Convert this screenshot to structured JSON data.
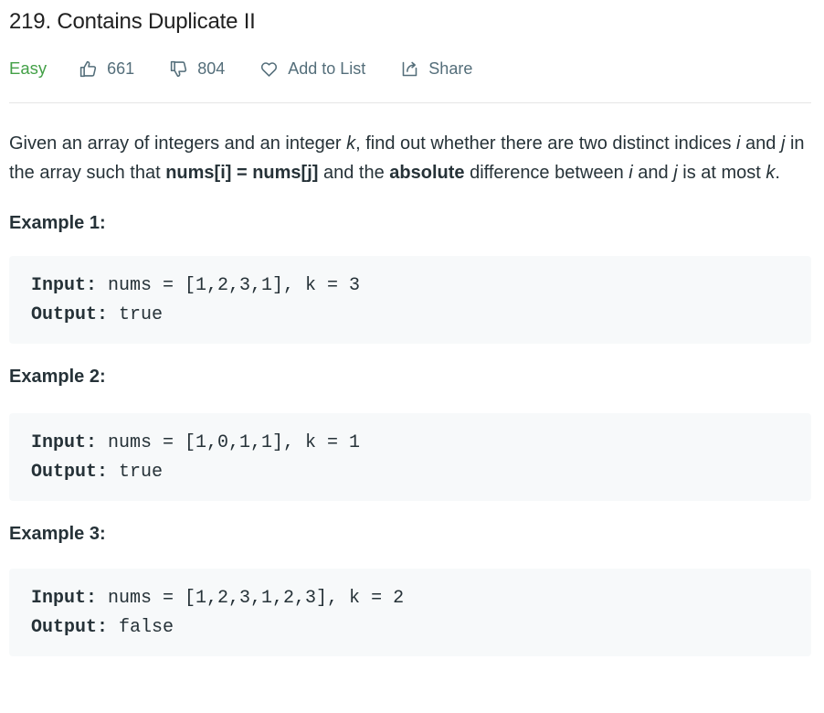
{
  "problem": {
    "title": "219. Contains Duplicate II",
    "difficulty": "Easy",
    "likes": "661",
    "dislikes": "804",
    "add_to_list_label": "Add to List",
    "share_label": "Share"
  },
  "description": {
    "t1": "Given an array of integers and an integer ",
    "k": "k",
    "t2": ", find out whether there are two distinct indices ",
    "i": "i",
    "t3": " and ",
    "j": "j",
    "t4": " in the array such that ",
    "eq": "nums[i] = nums[j]",
    "t5": " and the ",
    "abs": "absolute",
    "t6": " difference between ",
    "t7": " is at most ",
    "t8": "."
  },
  "examples": [
    {
      "title": "Example 1:",
      "input_label": "Input:",
      "input_value": " nums = [1,2,3,1], k = 3",
      "output_label": "Output:",
      "output_value": " true"
    },
    {
      "title": "Example 2:",
      "input_label": "Input:",
      "input_value": " nums = [1,0,1,1], k = 1",
      "output_label": "Output:",
      "output_value": " true"
    },
    {
      "title": "Example 3:",
      "input_label": "Input:",
      "input_value": " nums = [1,2,3,1,2,3], k = 2",
      "output_label": "Output:",
      "output_value": " false"
    }
  ],
  "colors": {
    "difficulty_easy": "#43a047",
    "meta_text": "#546e7a",
    "code_background": "#f7f9fa"
  },
  "icons": {
    "like": "thumbs-up-icon",
    "dislike": "thumbs-down-icon",
    "add_to_list": "heart-icon",
    "share": "share-icon"
  }
}
